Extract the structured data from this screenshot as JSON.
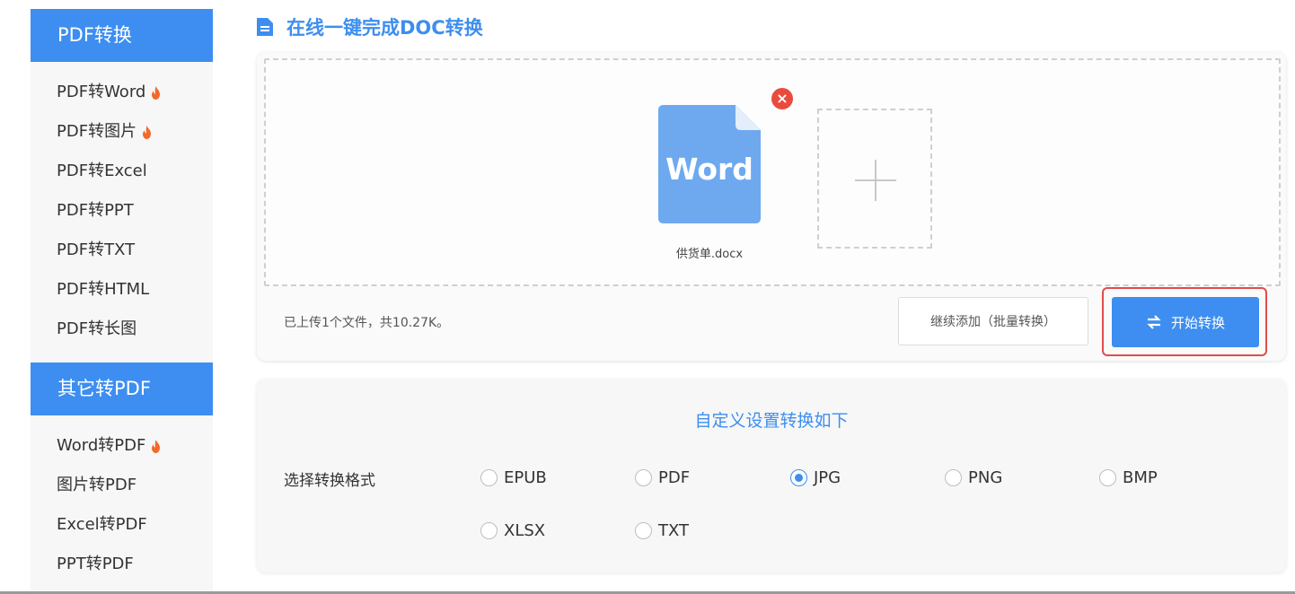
{
  "sidebar": {
    "groups": [
      {
        "title": "PDF转换",
        "items": [
          {
            "label": "PDF转Word",
            "hot": true
          },
          {
            "label": "PDF转图片",
            "hot": true
          },
          {
            "label": "PDF转Excel",
            "hot": false
          },
          {
            "label": "PDF转PPT",
            "hot": false
          },
          {
            "label": "PDF转TXT",
            "hot": false
          },
          {
            "label": "PDF转HTML",
            "hot": false
          },
          {
            "label": "PDF转长图",
            "hot": false
          }
        ]
      },
      {
        "title": "其它转PDF",
        "items": [
          {
            "label": "Word转PDF",
            "hot": true
          },
          {
            "label": "图片转PDF",
            "hot": false
          },
          {
            "label": "Excel转PDF",
            "hot": false
          },
          {
            "label": "PPT转PDF",
            "hot": false
          }
        ]
      }
    ]
  },
  "page_title": "在线一键完成DOC转换",
  "upload": {
    "file": {
      "icon_text": "Word",
      "name": "供货单.docx"
    },
    "remove_icon": "close-icon",
    "status": "已上传1个文件，共10.27K。",
    "continue_label": "继续添加（批量转换）",
    "start_label": "开始转换"
  },
  "settings": {
    "title": "自定义设置转换如下",
    "format_label": "选择转换格式",
    "formats": [
      {
        "label": "EPUB",
        "selected": false
      },
      {
        "label": "PDF",
        "selected": false
      },
      {
        "label": "JPG",
        "selected": true
      },
      {
        "label": "PNG",
        "selected": false
      },
      {
        "label": "BMP",
        "selected": false
      },
      {
        "label": "XLSX",
        "selected": false
      },
      {
        "label": "TXT",
        "selected": false
      }
    ]
  },
  "colors": {
    "accent": "#3d8ef0",
    "highlight_border": "#e24c4c",
    "hot_icon": "#f2692a",
    "remove_badge": "#e84c3d"
  }
}
